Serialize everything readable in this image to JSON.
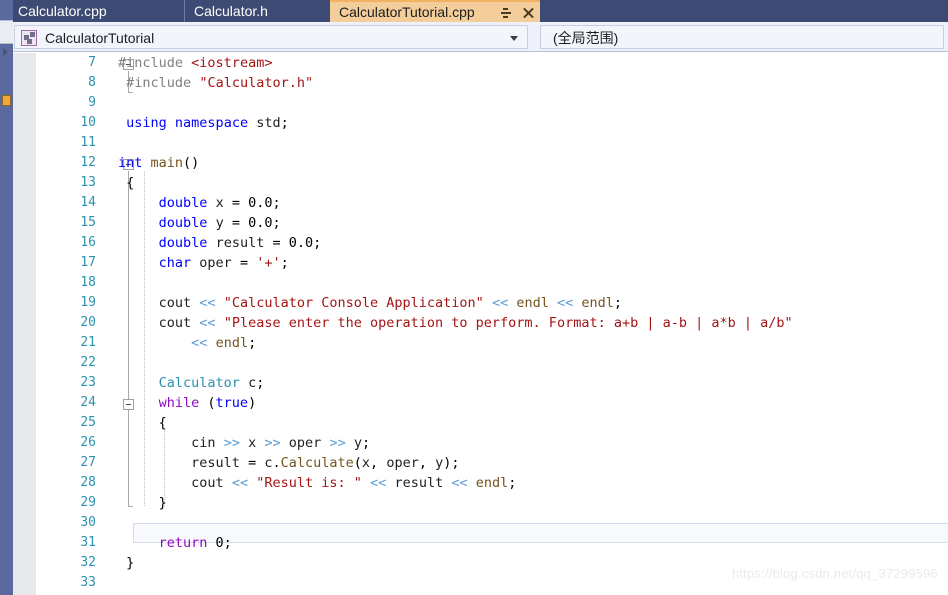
{
  "window": {
    "app": "Visual Studio Code Editor"
  },
  "tabs": [
    {
      "label": "Calculator.cpp",
      "active": false
    },
    {
      "label": "Calculator.h",
      "active": false
    },
    {
      "label": "CalculatorTutorial.cpp",
      "active": true
    }
  ],
  "tab_actions": {
    "pin": "pin-icon",
    "close": "close-icon"
  },
  "navbar": {
    "type_combo": {
      "value": "CalculatorTutorial",
      "icon": "project-icon",
      "arrow": "chevron-down-icon"
    },
    "scope_combo": {
      "value": "(全局范围)"
    }
  },
  "editor": {
    "current_line": 28,
    "first_visible_line": 7,
    "last_visible_line": 33,
    "colors": {
      "keyword": "#0000ff",
      "keyword_control": "#8f08c4",
      "string": "#a31515",
      "preprocessor": "#808080",
      "type": "#2b91af",
      "function": "#74531f",
      "shift_operator": "#5b9bd5",
      "line_number": "#2b91af",
      "background": "#ffffff",
      "indicator_margin": "#e8e9eb",
      "active_tab": "#f3ce9a",
      "tab_bar": "#3d4a73"
    },
    "lines": [
      {
        "n": 7,
        "text": "#include <iostream>"
      },
      {
        "n": 8,
        "text": "#include \"Calculator.h\""
      },
      {
        "n": 9,
        "text": ""
      },
      {
        "n": 10,
        "text": "using namespace std;"
      },
      {
        "n": 11,
        "text": ""
      },
      {
        "n": 12,
        "text": "int main()"
      },
      {
        "n": 13,
        "text": "{"
      },
      {
        "n": 14,
        "text": "    double x = 0.0;"
      },
      {
        "n": 15,
        "text": "    double y = 0.0;"
      },
      {
        "n": 16,
        "text": "    double result = 0.0;"
      },
      {
        "n": 17,
        "text": "    char oper = '+';"
      },
      {
        "n": 18,
        "text": ""
      },
      {
        "n": 19,
        "text": "    cout << \"Calculator Console Application\" << endl << endl;"
      },
      {
        "n": 20,
        "text": "    cout << \"Please enter the operation to perform. Format: a+b | a-b | a*b | a/b\""
      },
      {
        "n": 21,
        "text": "        << endl;"
      },
      {
        "n": 22,
        "text": ""
      },
      {
        "n": 23,
        "text": "    Calculator c;"
      },
      {
        "n": 24,
        "text": "    while (true)"
      },
      {
        "n": 25,
        "text": "    {"
      },
      {
        "n": 26,
        "text": "        cin >> x >> oper >> y;"
      },
      {
        "n": 27,
        "text": "        result = c.Calculate(x, oper, y);"
      },
      {
        "n": 28,
        "text": "        cout << \"Result is: \" << result << endl;"
      },
      {
        "n": 29,
        "text": "    }"
      },
      {
        "n": 30,
        "text": ""
      },
      {
        "n": 31,
        "text": "    return 0;"
      },
      {
        "n": 32,
        "text": "}"
      },
      {
        "n": 33,
        "text": ""
      }
    ]
  },
  "watermark": {
    "text": "https://blog.csdn.net/qq_37299596"
  }
}
